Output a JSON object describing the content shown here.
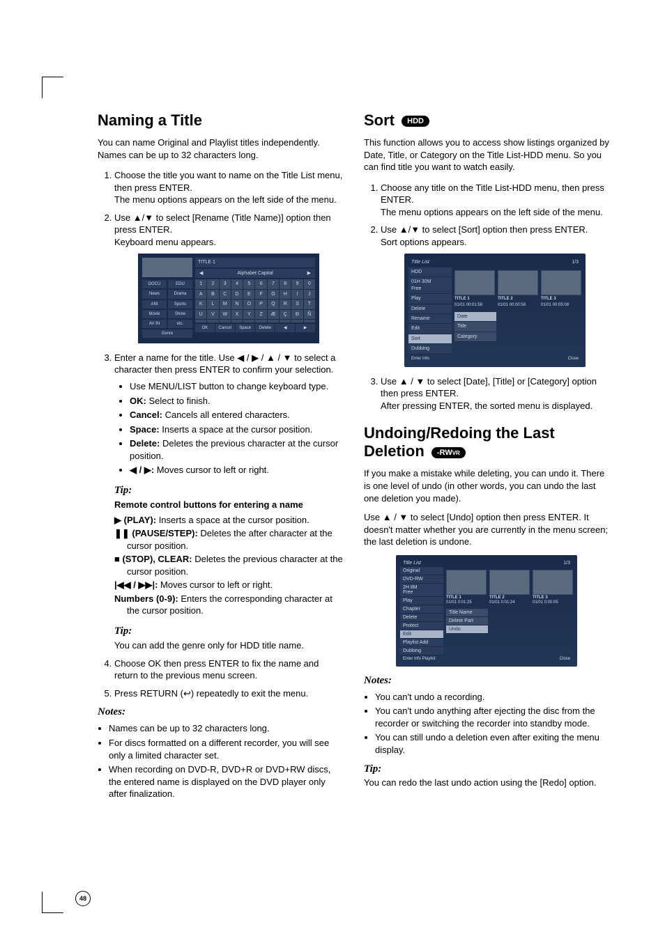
{
  "pageNumber": "48",
  "left": {
    "h1": "Naming a Title",
    "intro": "You can name Original and Playlist titles independently. Names can be up to 32 characters long.",
    "step1a": "Choose the title you want to name on the Title List menu, then press ENTER.",
    "step1b": "The menu options appears on the left side of the menu.",
    "step2a": "Use ▲/▼ to select [Rename (Title Name)] option then press ENTER.",
    "step2b": "Keyboard menu appears.",
    "kb": {
      "title": "TITLE  1",
      "capLeft": "◀",
      "capLabel": "Alphabet Capital",
      "capRight": "▶",
      "cats": [
        "DOCU",
        "EDU",
        "News",
        "Drama",
        "ANI",
        "Sports",
        "Movie",
        "Show",
        "AV IN",
        "etc.",
        "Genre"
      ],
      "keys": [
        "1",
        "2",
        "3",
        "4",
        "5",
        "6",
        "7",
        "8",
        "9",
        "0",
        "A",
        "B",
        "C",
        "D",
        "E",
        "F",
        "G",
        "H",
        "I",
        "J",
        "K",
        "L",
        "M",
        "N",
        "O",
        "P",
        "Q",
        "R",
        "S",
        "T",
        "U",
        "V",
        "W",
        "X",
        "Y",
        "Z",
        "Æ",
        "Ç",
        "Ð",
        "Ñ",
        "",
        "",
        "",
        "",
        "",
        "",
        "",
        "",
        "",
        ""
      ],
      "fns": [
        "OK",
        "Cancel",
        "Space",
        "Delete",
        "◀",
        "▶"
      ]
    },
    "step3a": "Enter a name for the title. Use ◀ / ▶ / ▲ / ▼ to select a character then press ENTER to confirm your selection.",
    "b1": "Use MENU/LIST button to change keyboard type.",
    "b2_k": "OK:",
    "b2_v": " Select to finish.",
    "b3_k": "Cancel:",
    "b3_v": " Cancels all entered characters.",
    "b4_k": "Space:",
    "b4_v": " Inserts a space at the cursor position.",
    "b5_k": "Delete:",
    "b5_v": " Deletes the previous character at the cursor position.",
    "b6_k": "◀ / ▶:",
    "b6_v": " Moves cursor to left or right.",
    "tip1Label": "Tip:",
    "tip1Head": "Remote control buttons for entering a name",
    "d1_k": "▶ (PLAY):",
    "d1_v": " Inserts a space at the cursor position.",
    "d2_k": "❚❚ (PAUSE/STEP):",
    "d2_v": " Deletes the after character at the cursor position.",
    "d3_k": "■ (STOP), CLEAR:",
    "d3_v": " Deletes the previous character at the cursor position.",
    "d4_k": "|◀◀ / ▶▶|:",
    "d4_v": " Moves cursor to left or right.",
    "d5_k": "Numbers (0-9):",
    "d5_v": " Enters the corresponding character at the cursor position.",
    "tip2Label": "Tip:",
    "tip2Text": "You can add the genre only for HDD title name.",
    "step4": "Choose OK then press ENTER to fix the name and return to the previous menu screen.",
    "step5": "Press RETURN (↩) repeatedly to exit the menu.",
    "notesLabel": "Notes:",
    "n1": "Names can be up to 32 characters long.",
    "n2": "For discs formatted on a different recorder, you will see only a limited character set.",
    "n3": "When recording on DVD-R, DVD+R or DVD+RW discs, the entered name is displayed on the DVD player only after finalization."
  },
  "right": {
    "h1a": "Sort ",
    "badge1": "HDD",
    "intro": "This function allows you to access show listings organized by Date, Title, or Category on the Title List-HDD menu. So you can find title you want to watch easily.",
    "step1a": "Choose any title on the Title List-HDD menu, then press ENTER.",
    "step1b": "The menu options appears on the left side of the menu.",
    "step2a": "Use ▲/▼ to select [Sort] option then press ENTER.",
    "step2b": "Sort options appears.",
    "ss1": {
      "title": "Title List",
      "hdd": "HDD",
      "counter": "1/3",
      "free": "01H 30M\nFree",
      "t1": "TITLE 1",
      "t1d": "01/01   00:01:58",
      "t2": "TITLE 2",
      "t2d": "01/01   00:00:58",
      "t3": "TITLE 3",
      "t3d": "01/01   00:05:08",
      "menu": [
        "Play",
        "Delete",
        "Rename",
        "Edit",
        "Sort",
        "Dubbing"
      ],
      "sub": [
        "Date",
        "Title",
        "Category"
      ],
      "footL": "Enter          Info",
      "footR": "Close"
    },
    "step3a": "Use ▲ / ▼ to select [Date], [Title] or [Category] option then press ENTER.",
    "step3b": "After pressing ENTER, the sorted menu is displayed.",
    "h2a": "Undoing/Redoing the Last Deletion ",
    "badge2a": "-RW",
    "badge2b": "VR",
    "p1": "If you make a mistake while deleting, you can undo it. There is one level of undo (in other words, you can undo the last one deletion you made).",
    "p2": "Use ▲ / ▼ to select [Undo] option then press ENTER. It doesn't matter whether you are currently in the menu screen; the last deletion is undone.",
    "ss2": {
      "title": "Title List",
      "orig": "Original",
      "dvd": "DVD-RW",
      "counter": "1/3",
      "free": "2H 8M\nFree",
      "t1": "TITLE 1",
      "t1d": "01/01   0:01:25",
      "t2": "TITLE 2",
      "t2d": "01/01   0:01:24",
      "t3": "TITLE 3",
      "t3d": "01/01   0:00:05",
      "menu": [
        "Play",
        "Chapter",
        "Delete",
        "Protect",
        "Edit",
        "Playlist Add",
        "Dubbing"
      ],
      "sub": [
        "Title Name",
        "Delete Part",
        "Undo"
      ],
      "footL": "Enter          Info        Playlist",
      "footR": "Close"
    },
    "notesLabel": "Notes:",
    "n1": "You can't undo a recording.",
    "n2": "You can't undo anything after ejecting the disc from the recorder or switching the recorder into standby mode.",
    "n3": "You can still undo a deletion even after exiting the menu display.",
    "tipLabel": "Tip:",
    "tipText": "You can redo the last undo action using the [Redo] option."
  }
}
